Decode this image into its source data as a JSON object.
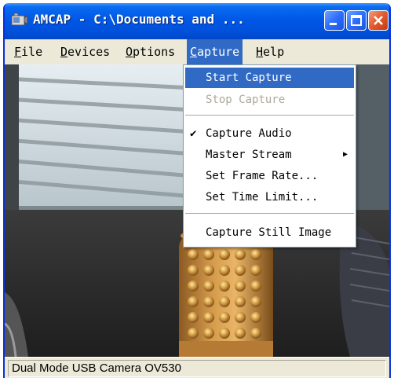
{
  "window": {
    "title": "AMCAP - C:\\Documents and ..."
  },
  "menubar": {
    "items": [
      {
        "label": "File"
      },
      {
        "label": "Devices"
      },
      {
        "label": "Options"
      },
      {
        "label": "Capture"
      },
      {
        "label": "Help"
      }
    ]
  },
  "capture_menu": {
    "start_capture": "Start Capture",
    "stop_capture": "Stop Capture",
    "capture_audio": "Capture Audio",
    "capture_audio_check": "✔",
    "master_stream": "Master Stream",
    "master_stream_arrow": "▶",
    "set_frame_rate": "Set Frame Rate...",
    "set_time_limit": "Set Time Limit...",
    "capture_still_image": "Capture Still Image"
  },
  "statusbar": {
    "text": "Dual Mode USB Camera OV530"
  },
  "colors": {
    "titlebar": "#0058e6",
    "menu_highlight": "#316ac5",
    "disabled_text": "#aca899",
    "window_face": "#ece9d8"
  },
  "icons": {
    "app": "camera-app-icon",
    "minimize": "minimize-icon",
    "maximize": "maximize-icon",
    "close": "close-icon",
    "check": "checkmark-icon",
    "submenu": "submenu-arrow-icon"
  }
}
